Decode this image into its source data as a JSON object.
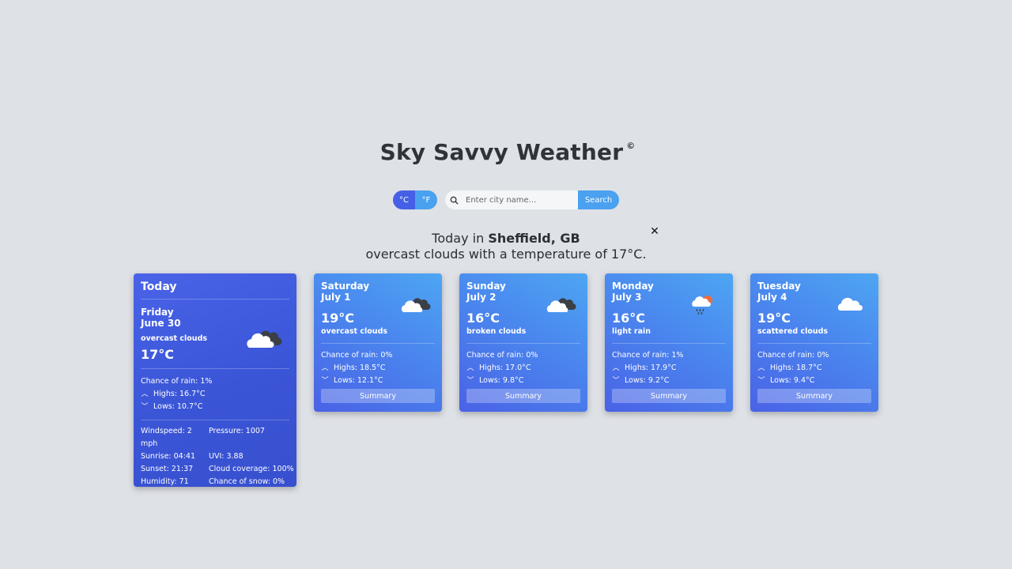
{
  "header": {
    "title": "Sky Savvy Weather",
    "copyright": "©"
  },
  "units": {
    "celsius": "°C",
    "fahrenheit": "°F"
  },
  "search": {
    "placeholder": "Enter city name...",
    "button": "Search"
  },
  "summary": {
    "prefix": "Today in",
    "location": "Sheffield, GB",
    "line2": "overcast clouds with a temperature of 17°C."
  },
  "today": {
    "heading": "Today",
    "day": "Friday",
    "date": "June 30",
    "desc": "overcast clouds",
    "temp": "17°C",
    "rain": "Chance of rain: 1%",
    "highs": "Highs: 16.7°C",
    "lows": "Lows: 10.7°C",
    "icon": "overcast-cloud-icon",
    "details": [
      [
        "Windspeed: 2 mph",
        "Pressure: 1007"
      ],
      [
        "Sunrise: 04:41",
        "UVI: 3.88"
      ],
      [
        "Sunset: 21:37",
        "Cloud coverage: 100%"
      ],
      [
        "Humidity: 71",
        "Chance of snow: 0%"
      ]
    ]
  },
  "forecast": [
    {
      "day": "Saturday",
      "date": "July 1",
      "temp": "19°C",
      "desc": "overcast clouds",
      "rain": "Chance of rain: 0%",
      "highs": "Highs: 18.5°C",
      "lows": "Lows: 12.1°C",
      "button": "Summary",
      "icon": "overcast-cloud-icon"
    },
    {
      "day": "Sunday",
      "date": "July 2",
      "temp": "16°C",
      "desc": "broken clouds",
      "rain": "Chance of rain: 0%",
      "highs": "Highs: 17.0°C",
      "lows": "Lows: 9.8°C",
      "button": "Summary",
      "icon": "broken-cloud-icon"
    },
    {
      "day": "Monday",
      "date": "July 3",
      "temp": "16°C",
      "desc": "light rain",
      "rain": "Chance of rain: 1%",
      "highs": "Highs: 17.9°C",
      "lows": "Lows: 9.2°C",
      "button": "Summary",
      "icon": "sun-rain-cloud-icon"
    },
    {
      "day": "Tuesday",
      "date": "July 4",
      "temp": "19°C",
      "desc": "scattered clouds",
      "rain": "Chance of rain: 0%",
      "highs": "Highs: 18.7°C",
      "lows": "Lows: 9.4°C",
      "button": "Summary",
      "icon": "scattered-cloud-icon"
    }
  ],
  "colors": {
    "background": "#dee1e6",
    "today_card": "#3a55d6",
    "accent_blue": "#4aa1f0",
    "unit_active": "#4560e6"
  }
}
